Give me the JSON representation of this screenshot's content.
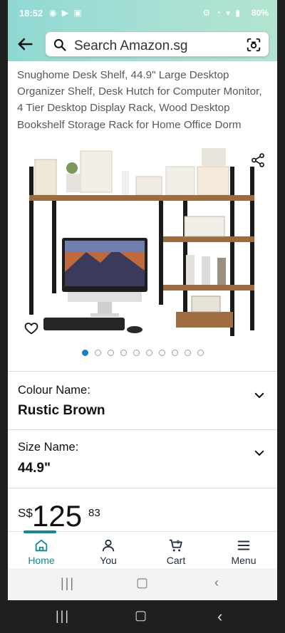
{
  "status_bar": {
    "time": "18:52",
    "left_icons": "◉ ▶ ▣",
    "right_icons": "⚙ ◔ ▾ ▮",
    "battery": "80%"
  },
  "search": {
    "placeholder": "Search Amazon.sg"
  },
  "product": {
    "title": "Snughome Desk Shelf, 44.9\" Large Desktop Organizer Shelf, Desk Hutch for Computer Monitor, 4 Tier Desktop Display Rack, Wood Desktop Bookshelf Storage Rack for Home Office Dorm",
    "image_count": 10,
    "active_image_index": 0
  },
  "variations": {
    "colour_label": "Colour Name:",
    "colour_value": "Rustic Brown",
    "size_label": "Size Name:",
    "size_value": "44.9\""
  },
  "price": {
    "symbol": "S$",
    "whole": "125",
    "fraction": "83"
  },
  "bottom_nav": {
    "items": [
      {
        "label": "Home",
        "icon": "home-icon",
        "active": true
      },
      {
        "label": "You",
        "icon": "person-icon",
        "active": false
      },
      {
        "label": "Cart",
        "icon": "cart-icon",
        "badge": "0",
        "active": false
      },
      {
        "label": "Menu",
        "icon": "menu-icon",
        "active": false
      }
    ]
  },
  "colors": {
    "header_gradient_start": "#8fd9d3",
    "header_gradient_end": "#b2e4cf",
    "accent": "#118a94",
    "active_dot": "#1c7fc2"
  }
}
